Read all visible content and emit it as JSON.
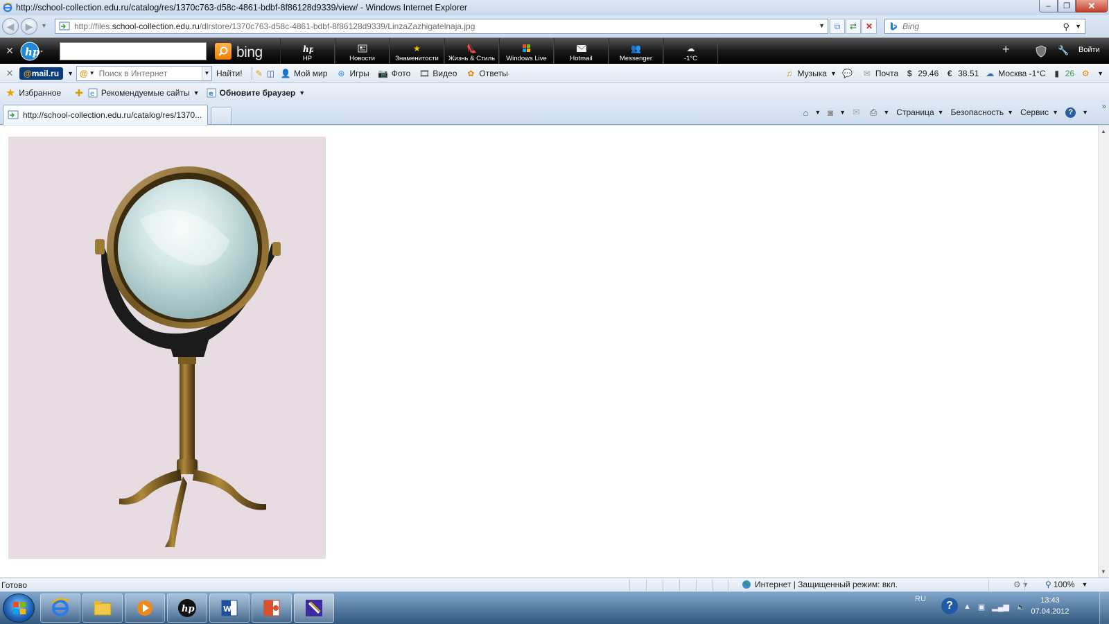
{
  "window": {
    "title": "http://school-collection.edu.ru/catalog/res/1370c763-d58c-4861-bdbf-8f86128d9339/view/ - Windows Internet Explorer"
  },
  "address": {
    "url_prefix": "http://files.",
    "url_domain": "school-collection.edu.ru",
    "url_path": "/dlrstore/1370c763-d58c-4861-bdbf-8f86128d9339/LinzaZazhigatelnaja.jpg"
  },
  "search": {
    "placeholder": "Bing"
  },
  "hp_toolbar": {
    "bing_label": "bing",
    "items": [
      {
        "label": "HP",
        "icon": "hp-icon"
      },
      {
        "label": "Новости",
        "icon": "news-icon"
      },
      {
        "label": "Знаменитости",
        "icon": "star-icon"
      },
      {
        "label": "Жизнь & Стиль",
        "icon": "shoe-icon"
      },
      {
        "label": "Windows Live",
        "icon": "windows-icon"
      },
      {
        "label": "Hotmail",
        "icon": "mail-icon"
      },
      {
        "label": "Messenger",
        "icon": "messenger-icon"
      },
      {
        "label": "-1°C",
        "icon": "cloud-icon"
      }
    ],
    "login_label": "Войти"
  },
  "mail_toolbar": {
    "logo_at": "@",
    "logo_text": "mail.ru",
    "search_placeholder": "Поиск в Интернет",
    "find_label": "Найти!",
    "items": [
      {
        "label": "Мой мир",
        "icon": "people-icon"
      },
      {
        "label": "Игры",
        "icon": "games-icon"
      },
      {
        "label": "Фото",
        "icon": "camera-icon"
      },
      {
        "label": "Видео",
        "icon": "video-icon"
      },
      {
        "label": "Ответы",
        "icon": "answers-icon"
      }
    ],
    "music_label": "Музыка",
    "mail_label": "Почта",
    "usd": "29.46",
    "eur": "38.51",
    "weather": "Москва -1°C",
    "counter": "26"
  },
  "favorites": {
    "favorites_label": "Избранное",
    "links": [
      {
        "label": "Рекомендуемые сайты"
      },
      {
        "label": "Обновите браузер"
      }
    ]
  },
  "tabs": {
    "active_title": "http://school-collection.edu.ru/catalog/res/1370..."
  },
  "command_bar": {
    "page_label": "Страница",
    "safety_label": "Безопасность",
    "tools_label": "Сервис"
  },
  "status": {
    "text": "Готово",
    "zone": "Интернет | Защищенный режим: вкл.",
    "zoom": "100%"
  },
  "taskbar": {
    "lang": "RU",
    "time": "13:43",
    "date": "07.04.2012"
  },
  "colors": {
    "image_background": "#e8dce3",
    "hp_bar": "#1a1a1a",
    "accent_blue": "#2d5e9c"
  }
}
